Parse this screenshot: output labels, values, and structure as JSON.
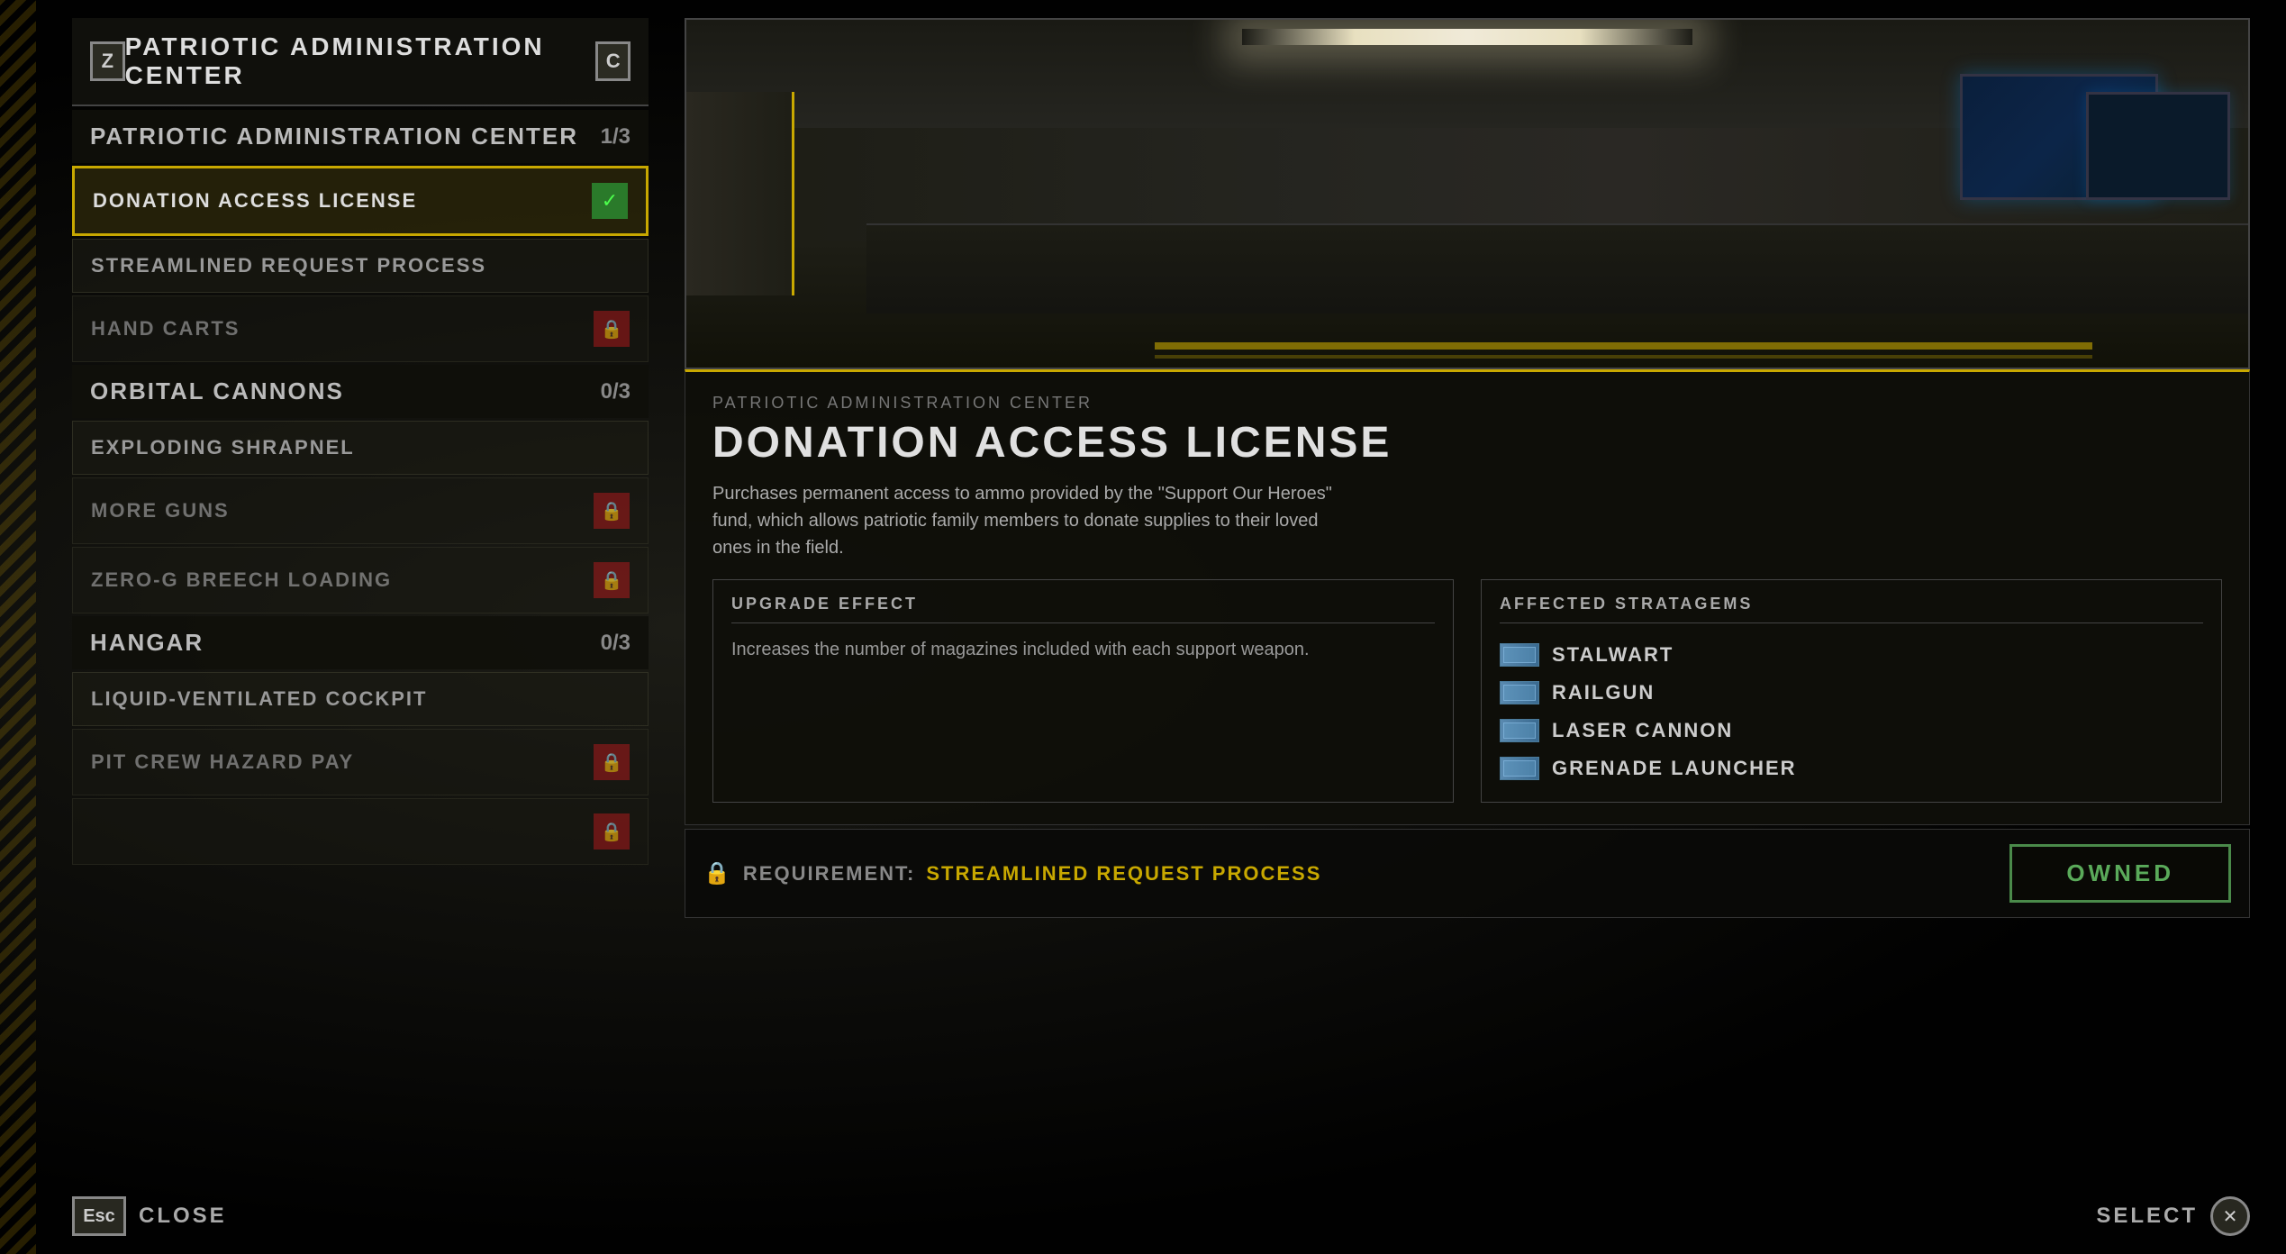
{
  "header": {
    "z_key": "Z",
    "c_key": "C",
    "title": "PATRIOTIC ADMINISTRATION CENTER"
  },
  "sections": [
    {
      "id": "patriotic-admin",
      "name": "PATRIOTIC ADMINISTRATION CENTER",
      "count": "1/3",
      "items": [
        {
          "id": "donation-access",
          "name": "DONATION ACCESS LICENSE",
          "status": "owned",
          "active": true
        },
        {
          "id": "streamlined-request",
          "name": "STREAMLINED REQUEST PROCESS",
          "status": "available",
          "active": false
        },
        {
          "id": "hand-carts",
          "name": "HAND CARTS",
          "status": "locked",
          "active": false
        }
      ]
    },
    {
      "id": "orbital-cannons",
      "name": "ORBITAL CANNONS",
      "count": "0/3",
      "items": [
        {
          "id": "exploding-shrapnel",
          "name": "EXPLODING SHRAPNEL",
          "status": "available",
          "active": false
        },
        {
          "id": "more-guns",
          "name": "MORE GUNS",
          "status": "locked",
          "active": false
        },
        {
          "id": "zero-g-breech",
          "name": "ZERO-G BREECH LOADING",
          "status": "locked",
          "active": false
        }
      ]
    },
    {
      "id": "hangar",
      "name": "HANGAR",
      "count": "0/3",
      "items": [
        {
          "id": "liquid-ventilated",
          "name": "LIQUID-VENTILATED COCKPIT",
          "status": "available",
          "active": false
        },
        {
          "id": "pit-crew",
          "name": "PIT CREW HAZARD PAY",
          "status": "locked",
          "active": false
        },
        {
          "id": "hidden-item",
          "name": "",
          "status": "locked",
          "active": false
        }
      ]
    }
  ],
  "detail": {
    "breadcrumb": "PATRIOTIC ADMINISTRATION CENTER",
    "title": "DONATION ACCESS LICENSE",
    "description": "Purchases permanent access to ammo provided by the \"Support Our Heroes\" fund, which allows patriotic family members to donate supplies to their loved ones in the field.",
    "upgrade_effect": {
      "label": "UPGRADE EFFECT",
      "text": "Increases the number of magazines included with each support weapon."
    },
    "affected_stratagems": {
      "label": "AFFECTED STRATAGEMS",
      "items": [
        {
          "id": "stalwart",
          "name": "STALWART"
        },
        {
          "id": "railgun",
          "name": "RAILGUN"
        },
        {
          "id": "laser-cannon",
          "name": "LASER CANNON"
        },
        {
          "id": "grenade-launcher",
          "name": "GRENADE LAUNCHER"
        }
      ]
    },
    "requirement": {
      "label": "REQUIREMENT:",
      "value": "STREAMLINED REQUEST PROCESS"
    },
    "owned_button": "OWNED"
  },
  "bottom": {
    "esc_key": "Esc",
    "close_label": "CLOSE",
    "select_label": "SELECT"
  }
}
